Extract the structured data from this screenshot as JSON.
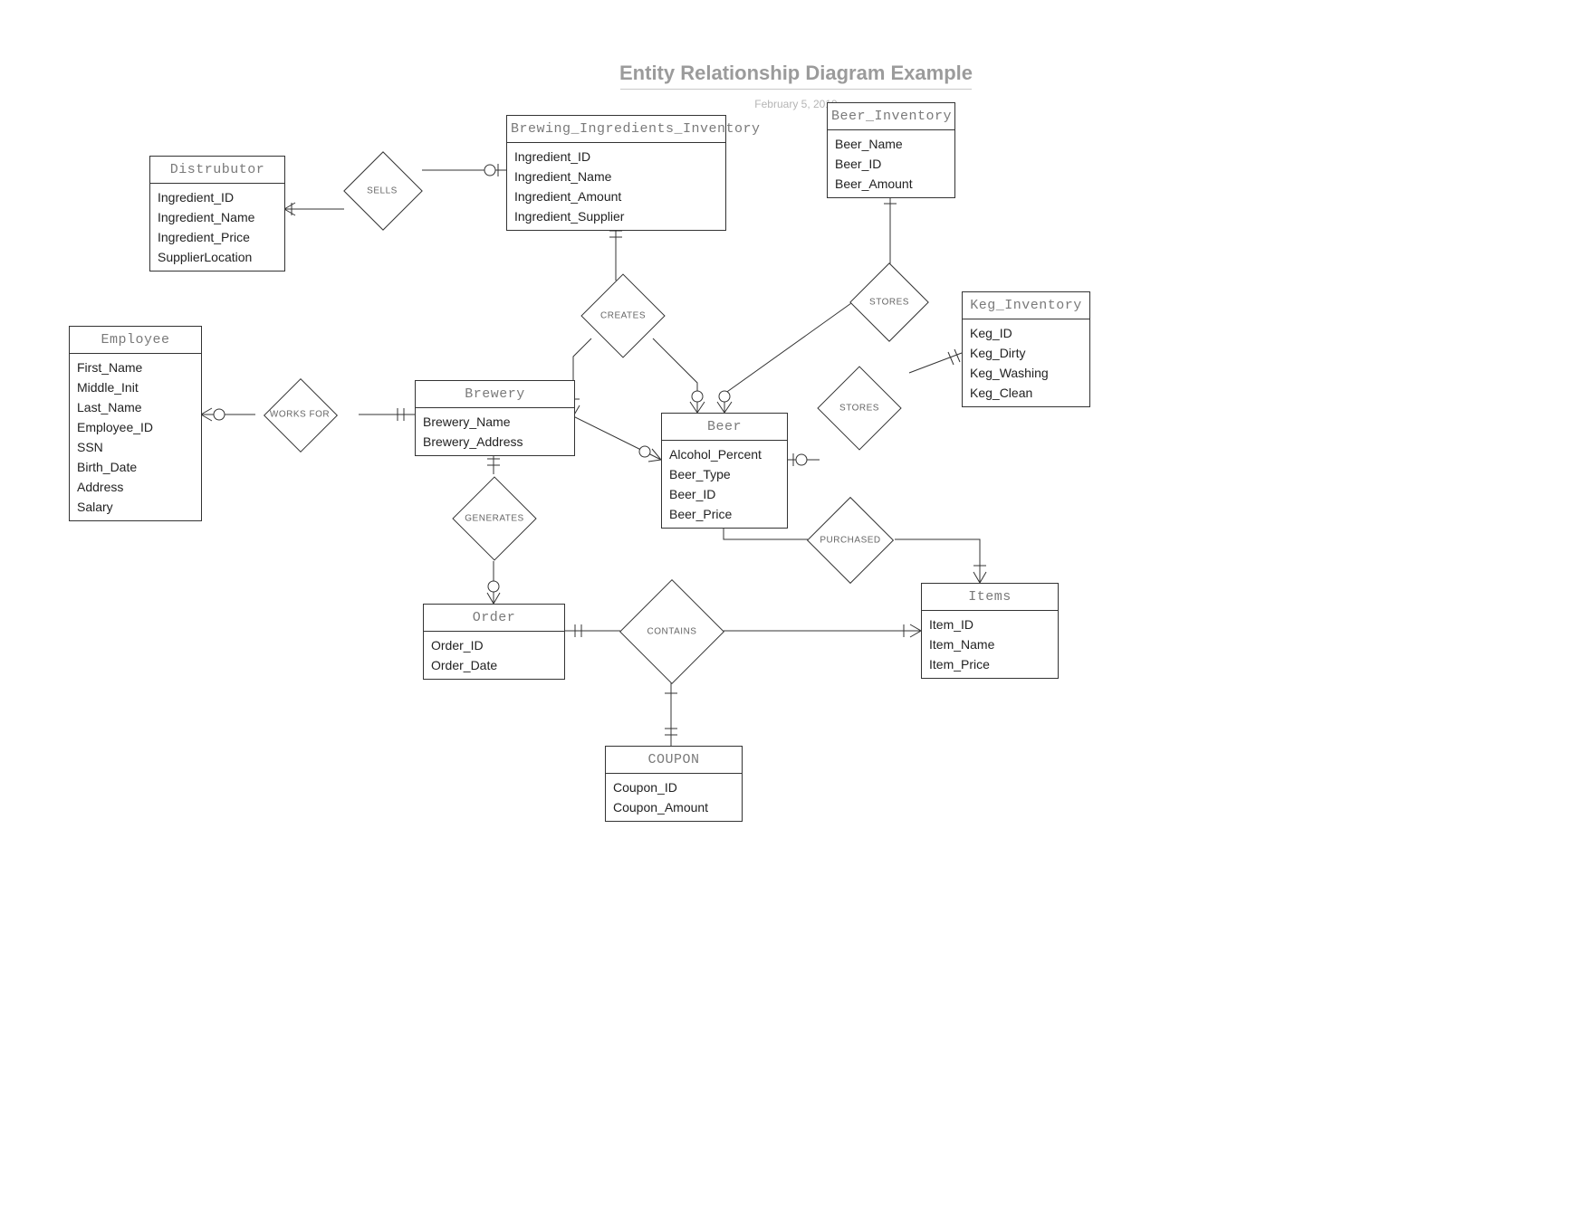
{
  "title": "Entity Relationship Diagram Example",
  "date": "February 5, 2019",
  "entities": {
    "distributor": {
      "name": "Distrubutor",
      "attrs": [
        "Ingredient_ID",
        "Ingredient_Name",
        "Ingredient_Price",
        "SupplierLocation"
      ]
    },
    "brewing_ingredients": {
      "name": "Brewing_Ingredients_Inventory",
      "attrs": [
        "Ingredient_ID",
        "Ingredient_Name",
        "Ingredient_Amount",
        "Ingredient_Supplier"
      ]
    },
    "beer_inventory": {
      "name": "Beer_Inventory",
      "attrs": [
        "Beer_Name",
        "Beer_ID",
        "Beer_Amount"
      ]
    },
    "employee": {
      "name": "Employee",
      "attrs": [
        "First_Name",
        "Middle_Init",
        "Last_Name",
        "Employee_ID",
        "SSN",
        "Birth_Date",
        "Address",
        "Salary"
      ]
    },
    "brewery": {
      "name": "Brewery",
      "attrs": [
        "Brewery_Name",
        "Brewery_Address"
      ]
    },
    "beer": {
      "name": "Beer",
      "attrs": [
        "Alcohol_Percent",
        "Beer_Type",
        "Beer_ID",
        "Beer_Price"
      ]
    },
    "keg_inventory": {
      "name": "Keg_Inventory",
      "attrs": [
        "Keg_ID",
        "Keg_Dirty",
        "Keg_Washing",
        "Keg_Clean"
      ]
    },
    "order": {
      "name": "Order",
      "attrs": [
        "Order_ID",
        "Order_Date"
      ]
    },
    "items": {
      "name": "Items",
      "attrs": [
        "Item_ID",
        "Item_Name",
        "Item_Price"
      ]
    },
    "coupon": {
      "name": "COUPON",
      "attrs": [
        "Coupon_ID",
        "Coupon_Amount"
      ]
    }
  },
  "relationships": {
    "sells": "SELLS",
    "creates": "CREATES",
    "stores1": "STORES",
    "stores2": "STORES",
    "works_for": "WORKS FOR",
    "generates": "GENERATES",
    "purchased": "PURCHASED",
    "contains": "CONTAINS"
  }
}
